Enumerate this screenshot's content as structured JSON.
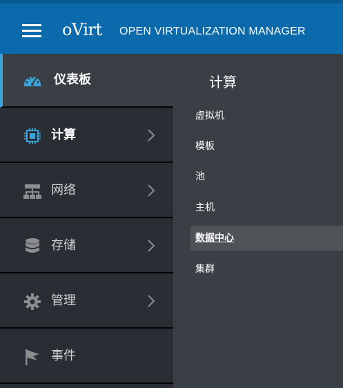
{
  "header": {
    "logo": "oVirt",
    "app_title": "OPEN VIRTUALIZATION MANAGER"
  },
  "sidebar": {
    "items": [
      {
        "label": "仪表板",
        "icon": "dashboard-icon"
      },
      {
        "label": "计算",
        "icon": "cpu-icon",
        "has_submenu": true
      },
      {
        "label": "网络",
        "icon": "network-icon",
        "has_submenu": true
      },
      {
        "label": "存储",
        "icon": "database-icon",
        "has_submenu": true
      },
      {
        "label": "管理",
        "icon": "gear-icon",
        "has_submenu": true
      },
      {
        "label": "事件",
        "icon": "flag-icon"
      }
    ]
  },
  "submenu": {
    "title": "计算",
    "items": [
      "虚拟机",
      "模板",
      "池",
      "主机",
      "数据中心",
      "集群"
    ],
    "current": "数据中心"
  },
  "colors": {
    "header_bg": "#0b6aab",
    "sidebar_bg": "#292e34",
    "active_bg": "#393f44",
    "accent": "#39a5dc",
    "icon_blue": "#39a5dc",
    "icon_gray": "#8b8d8f"
  }
}
